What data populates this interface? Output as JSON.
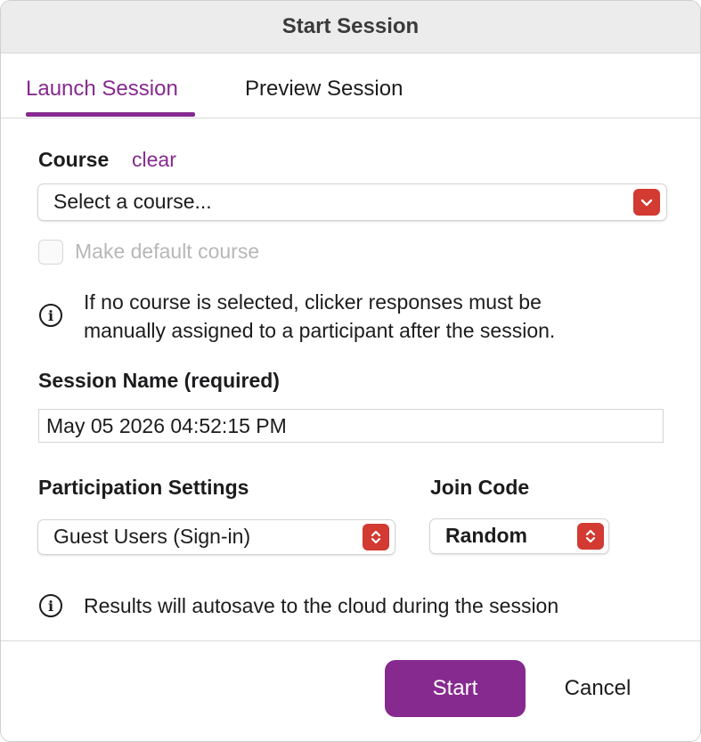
{
  "window": {
    "title": "Start Session"
  },
  "tabs": [
    {
      "label": "Launch Session",
      "active": true
    },
    {
      "label": "Preview Session",
      "active": false
    }
  ],
  "course": {
    "label": "Course",
    "clear_label": "clear",
    "select_value": "Select a course...",
    "default_checkbox_label": "Make default course",
    "default_checked": false,
    "info_line1": "If no course is selected, clicker responses must be",
    "info_line2": "manually assigned to a participant after the session."
  },
  "session_name": {
    "label": "Session Name (required)",
    "value": "May 05 2026 04:52:15 PM"
  },
  "participation": {
    "label": "Participation Settings",
    "value": "Guest Users (Sign-in)"
  },
  "join_code": {
    "label": "Join Code",
    "value": "Random"
  },
  "autosave_note": "Results will autosave to the cloud during the session",
  "footer": {
    "start_label": "Start",
    "cancel_label": "Cancel"
  },
  "icons": {
    "info": "info-circle-icon",
    "chevron": "chevron-down-icon",
    "updown": "chevron-up-down-icon"
  },
  "colors": {
    "accent": "#862a8f",
    "stepper": "#d23a32"
  }
}
